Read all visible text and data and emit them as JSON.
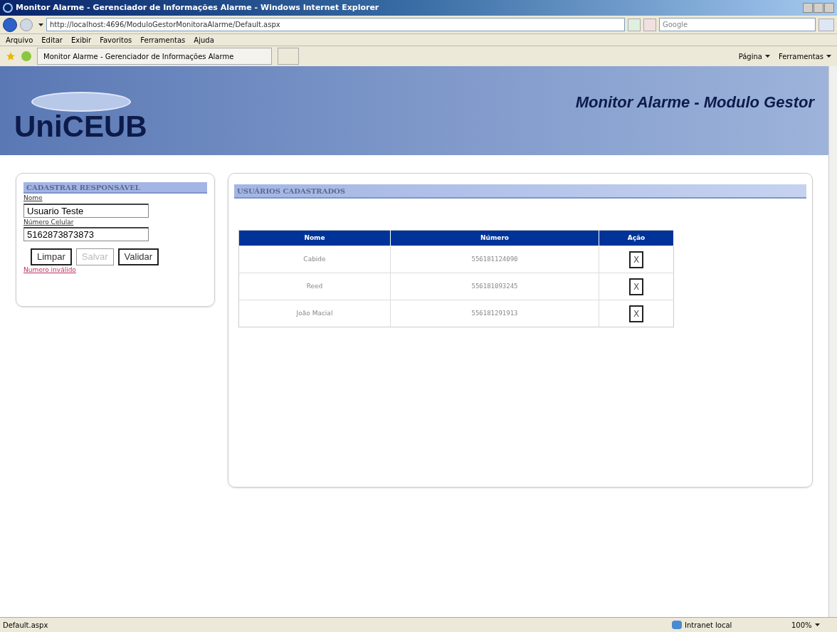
{
  "window": {
    "title": "Monitor Alarme - Gerenciador de Informações Alarme - Windows Internet Explorer"
  },
  "address_bar": {
    "url": "http://localhost:4696/ModuloGestorMonitoraAlarme/Default.aspx"
  },
  "search": {
    "placeholder": "Google"
  },
  "menu": [
    "Arquivo",
    "Editar",
    "Exibir",
    "Favoritos",
    "Ferramentas",
    "Ajuda"
  ],
  "tab": {
    "title": "Monitor Alarme - Gerenciador de Informações Alarme"
  },
  "command_bar": [
    "Página",
    "Ferramentas"
  ],
  "header": {
    "logo": "UniCEUB",
    "title": "Monitor Alarme - Modulo Gestor"
  },
  "form": {
    "title": "CADASTRAR RESPONSÁVEL",
    "fields": [
      {
        "label": "Nome",
        "value": "Usuario Teste"
      },
      {
        "label": "Número Celular",
        "value": "5162873873873"
      }
    ],
    "buttons": [
      {
        "label": "Limpar",
        "disabled": false
      },
      {
        "label": "Salvar",
        "disabled": true
      },
      {
        "label": "Validar",
        "disabled": false
      }
    ],
    "error": "Numero inválido"
  },
  "users": {
    "title": "USUÁRIOS CADASTRADOS",
    "columns": [
      "Nome",
      "Número",
      "Ação"
    ],
    "rows": [
      {
        "name": "Cabide",
        "number": "556181124090",
        "action": "X"
      },
      {
        "name": "Reed",
        "number": "556181093245",
        "action": "X"
      },
      {
        "name": "João Macial",
        "number": "556181291913",
        "action": "X"
      }
    ]
  },
  "status_bar": {
    "text": "Default.aspx",
    "zone": "Intranet local",
    "zoom": "100%"
  }
}
